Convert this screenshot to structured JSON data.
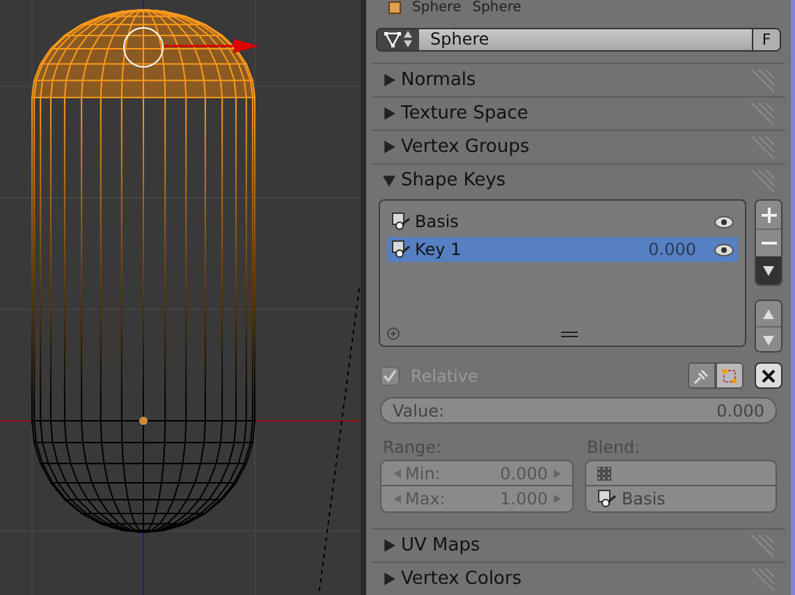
{
  "breadcrumb": [
    "Sphere",
    "Sphere"
  ],
  "mesh_selector": {
    "name": "Sphere",
    "fake_user": "F"
  },
  "panels": [
    {
      "title": "Normals",
      "expanded": false
    },
    {
      "title": "Texture Space",
      "expanded": false
    },
    {
      "title": "Vertex Groups",
      "expanded": false
    },
    {
      "title": "Shape Keys",
      "expanded": true
    }
  ],
  "shape_keys": [
    {
      "name": "Basis",
      "selected": false
    },
    {
      "name": "Key 1",
      "value": "0.000",
      "selected": true
    }
  ],
  "relative": {
    "label": "Relative",
    "checked": true
  },
  "value": {
    "label": "Value:",
    "value": "0.000"
  },
  "range": {
    "label": "Range:",
    "min_label": "Min:",
    "min": "0.000",
    "max_label": "Max:",
    "max": "1.000"
  },
  "blend": {
    "label": "Blend:",
    "shape": "Basis"
  },
  "lower_panels": [
    {
      "title": "UV Maps",
      "expanded": false
    },
    {
      "title": "Vertex Colors",
      "expanded": false
    }
  ]
}
